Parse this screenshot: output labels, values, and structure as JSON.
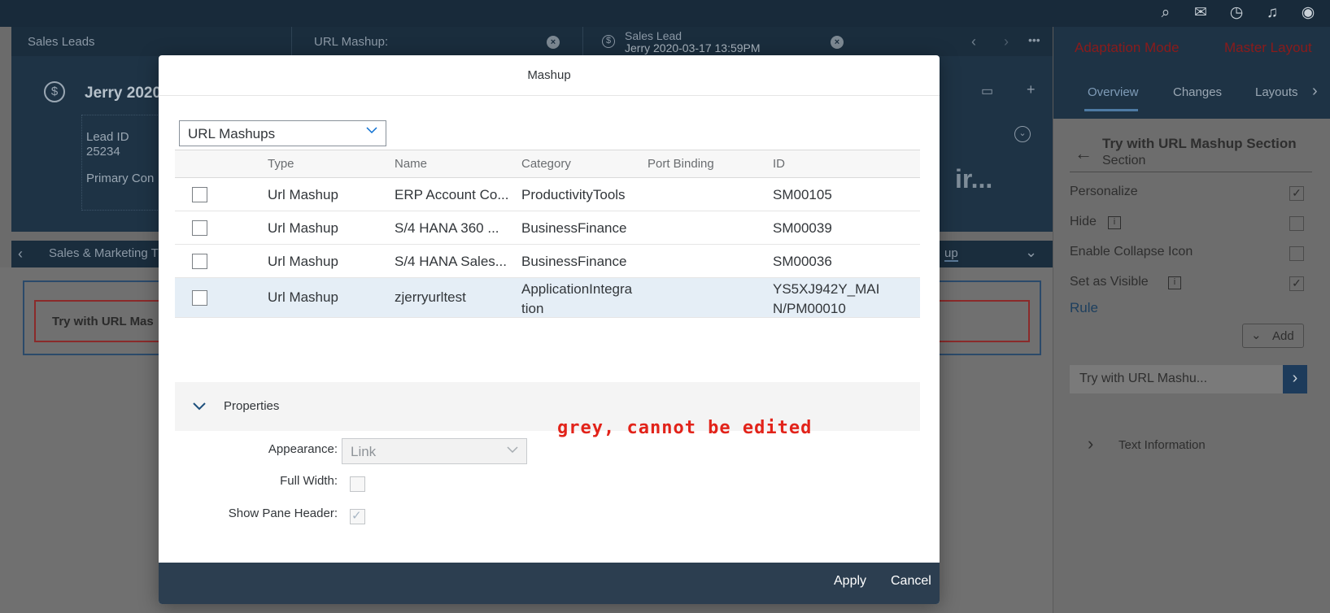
{
  "background": {
    "tabs": [
      {
        "label": "Sales Leads"
      },
      {
        "label": "URL Mashup:"
      },
      {
        "label": "Sales Lead",
        "sublabel": "Jerry 2020-03-17 13:59PM"
      }
    ],
    "header_title": "Jerry 2020-",
    "lead_id_label": "Lead ID",
    "lead_id_value": "25234",
    "primary_contact_label": "Primary Con",
    "header_overflow_text": "ir...",
    "subtab_label": "Sales & Marketing T",
    "subtab_right": "up",
    "section_title": "Try with URL Mas"
  },
  "right_panel": {
    "adaptation_mode": "Adaptation Mode",
    "master_layout": "Master Layout",
    "tabs": [
      "Overview",
      "Changes",
      "Layouts"
    ],
    "section_title": "Try with URL Mashup Section",
    "section_subtitle": "Section",
    "rows": [
      {
        "label": "Personalize",
        "checked": true
      },
      {
        "label": "Hide",
        "checked": false
      },
      {
        "label": "Enable Collapse Icon",
        "checked": false
      },
      {
        "label": "Set as Visible",
        "checked": true
      }
    ],
    "rule_link": "Rule",
    "add_button": "Add",
    "mashup_item": "Try with URL Mashu...",
    "text_information": "Text Information"
  },
  "dialog": {
    "title": "Mashup",
    "select_value": "URL Mashups",
    "columns": [
      "Type",
      "Name",
      "Category",
      "Port Binding",
      "ID"
    ],
    "rows": [
      {
        "type": "Url Mashup",
        "name": "ERP Account Co...",
        "category": "ProductivityTools",
        "port_binding": "",
        "id": "SM00105"
      },
      {
        "type": "Url Mashup",
        "name": "S/4 HANA 360 ...",
        "category": "BusinessFinance",
        "port_binding": "",
        "id": "SM00039"
      },
      {
        "type": "Url Mashup",
        "name": "S/4 HANA Sales...",
        "category": "BusinessFinance",
        "port_binding": "",
        "id": "SM00036"
      },
      {
        "type": "Url Mashup",
        "name": "zjerryurltest",
        "category": "ApplicationIntegration",
        "port_binding": "",
        "id": "YS5XJ942Y_MAIN/PM00010"
      }
    ],
    "properties_label": "Properties",
    "annotation": "grey, cannot be edited",
    "appearance_label": "Appearance:",
    "appearance_value": "Link",
    "full_width_label": "Full Width:",
    "show_pane_header_label": "Show Pane Header:",
    "apply_label": "Apply",
    "cancel_label": "Cancel"
  },
  "colors": {
    "shell": "#182a3a",
    "footer": "#2c3e50",
    "annotation": "#e2231a",
    "selected_row": "#e5eef6"
  }
}
